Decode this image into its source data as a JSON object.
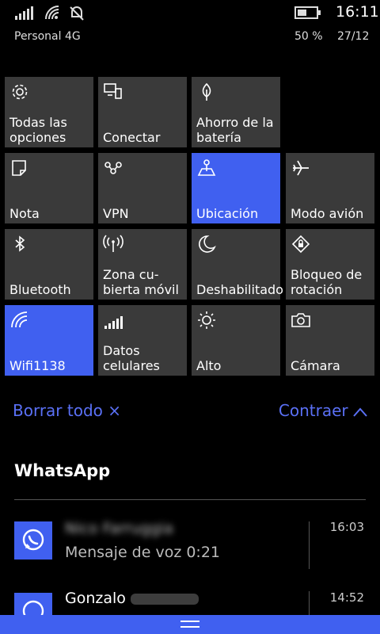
{
  "status": {
    "time": "16:11",
    "carrier": "Personal 4G",
    "battery": "50 %",
    "date": "27/12",
    "icons": [
      "signal-bars-icon",
      "wifi-icon",
      "quiet-hours-icon",
      "battery-icon"
    ]
  },
  "tiles": [
    {
      "label": "Todas las\nopciones",
      "icon": "gear-icon",
      "active": false
    },
    {
      "label": "Conectar",
      "icon": "connect-icon",
      "active": false
    },
    {
      "label": "Ahorro de la\nbatería",
      "icon": "battery-saver-icon",
      "active": false
    },
    {
      "label": "Nota",
      "icon": "note-icon",
      "active": false
    },
    {
      "label": "VPN",
      "icon": "vpn-icon",
      "active": false
    },
    {
      "label": "Ubicación",
      "icon": "location-icon",
      "active": true
    },
    {
      "label": "Modo avión",
      "icon": "airplane-icon",
      "active": false
    },
    {
      "label": "Bluetooth",
      "icon": "bluetooth-icon",
      "active": false
    },
    {
      "label": "Zona cu-\nbierta móvil",
      "icon": "hotspot-icon",
      "active": false
    },
    {
      "label": "Deshabilitado",
      "icon": "moon-icon",
      "active": false
    },
    {
      "label": "Bloqueo de\nrotación",
      "icon": "rotation-lock-icon",
      "active": false
    },
    {
      "label": "Wifi1138",
      "icon": "wifi-icon",
      "active": true
    },
    {
      "label": "Datos\ncelulares",
      "icon": "cellular-data-icon",
      "active": false
    },
    {
      "label": "Alto",
      "icon": "brightness-icon",
      "active": false
    },
    {
      "label": "Cámara",
      "icon": "camera-icon",
      "active": false
    }
  ],
  "actions": {
    "clear": "Borrar todo",
    "clear_glyph": "×",
    "collapse": "Contraer",
    "collapse_glyph": "^"
  },
  "group": {
    "app": "WhatsApp",
    "notifications": [
      {
        "title": "Nico Farruggia",
        "title_blurred": true,
        "body": "Mensaje de voz 0:21",
        "time": "16:03"
      },
      {
        "title": "Gonzalo",
        "title_suffix_blurred": true,
        "body": "",
        "time": "14:52"
      }
    ]
  },
  "colors": {
    "accent": "#4060f0",
    "accent_text": "#5a70f5",
    "tile": "#3a3a3a"
  }
}
